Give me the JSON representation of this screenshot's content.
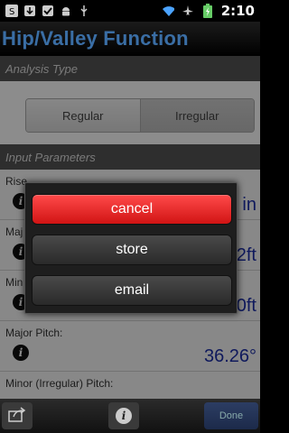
{
  "status_bar": {
    "time": "2:10",
    "icons": [
      "notification-s-icon",
      "download-icon",
      "checkbox-icon",
      "android-icon",
      "usb-icon",
      "wifi-icon",
      "airplane-icon",
      "battery-charging-icon"
    ]
  },
  "app": {
    "title": "Hip/Valley Function"
  },
  "analysis": {
    "header": "Analysis Type",
    "options": [
      "Regular",
      "Irregular"
    ],
    "selected": "Irregular"
  },
  "inputs": {
    "header": "Input Parameters",
    "rows": [
      {
        "label": "Rise",
        "value": "in"
      },
      {
        "label": "Maj",
        "value": "2ft"
      },
      {
        "label": "Min",
        "value": "0ft"
      },
      {
        "label": "Major Pitch:",
        "value": "36.26°"
      },
      {
        "label": "Minor (Irregular) Pitch:",
        "value": ""
      }
    ]
  },
  "dialog": {
    "buttons": [
      "cancel",
      "store",
      "email"
    ]
  },
  "bottom_bar": {
    "done_label": "Done",
    "icons": [
      "share-icon",
      "info-icon"
    ]
  },
  "colors": {
    "title": "#3a6ea5",
    "value": "#1d2fa8",
    "cancel": "#e22a2a"
  }
}
